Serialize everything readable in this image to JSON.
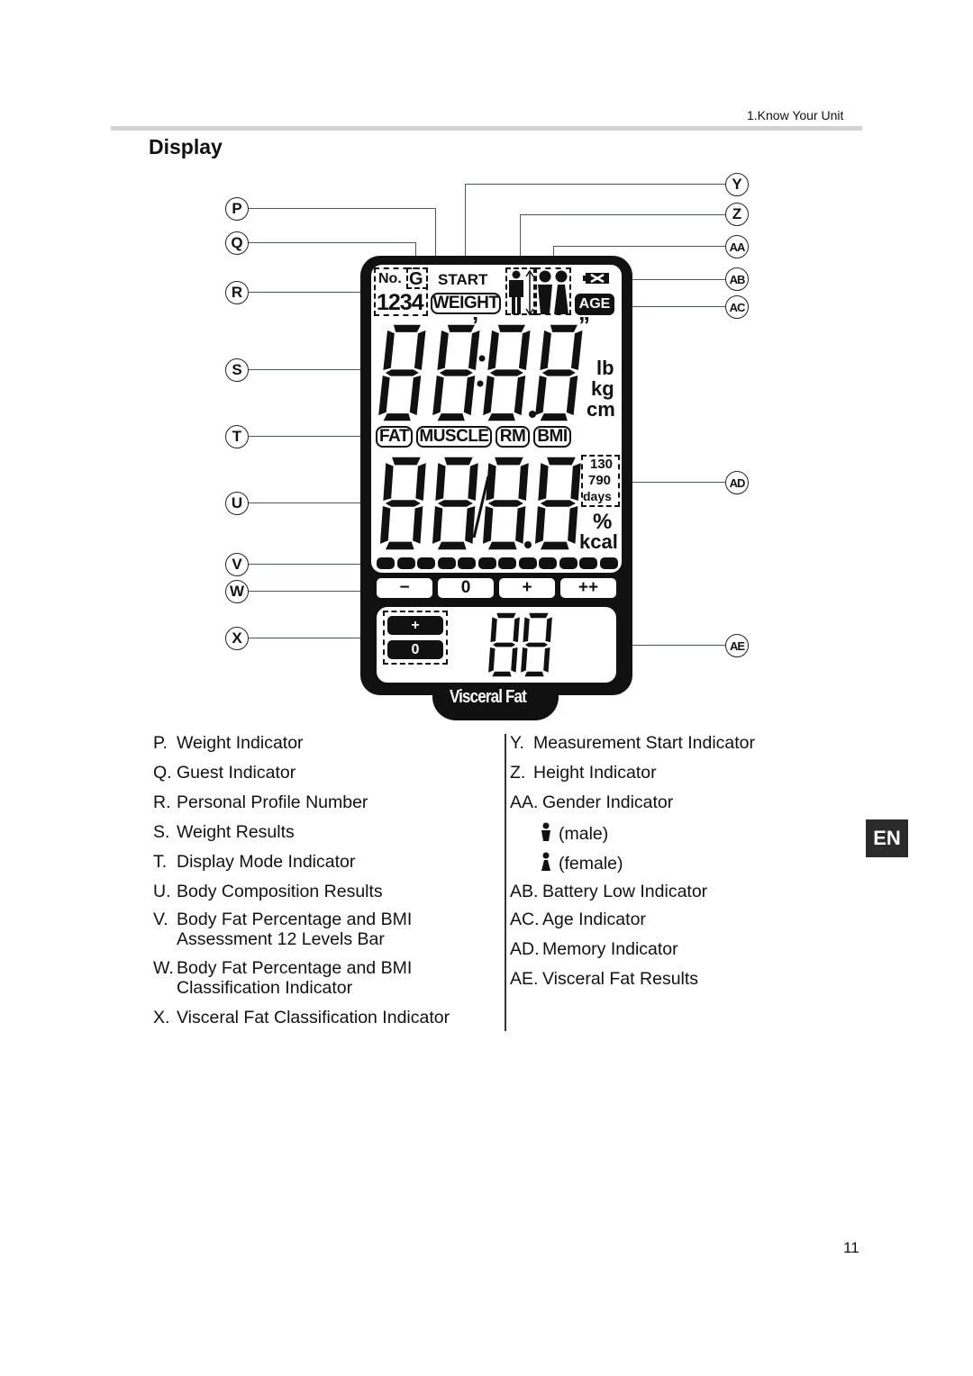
{
  "header": {
    "chapter": "1.Know Your Unit"
  },
  "section": {
    "title": "Display"
  },
  "diagram": {
    "callouts_left": [
      "P",
      "Q",
      "R",
      "S",
      "T",
      "U",
      "V",
      "W",
      "X"
    ],
    "callouts_right": [
      "Y",
      "Z",
      "AA",
      "AB",
      "AC",
      "AD",
      "AE"
    ],
    "lcd": {
      "no_label": "No.",
      "guest_label": "G",
      "start_label": "START",
      "profile_digits": "1234",
      "weight_label": "WEIGHT",
      "age_label": "AGE",
      "units_top": [
        "lb",
        "kg",
        "cm"
      ],
      "mode_labels": [
        "FAT",
        "MUSCLE",
        "RM",
        "BMI"
      ],
      "memory_values": [
        "130",
        "790",
        "days"
      ],
      "units_bottom": [
        "%",
        "kcal"
      ],
      "level_bar_segments": 12,
      "classification_buttons": [
        "−",
        "0",
        "+",
        "++"
      ],
      "visceral_buttons": [
        "+",
        "0"
      ],
      "visceral_label": "Visceral Fat",
      "prime_mark": "’",
      "double_prime_mark": "”"
    }
  },
  "legend_left": [
    {
      "key": "P.",
      "text": "Weight Indicator"
    },
    {
      "key": "Q.",
      "text": "Guest Indicator"
    },
    {
      "key": "R.",
      "text": "Personal Profile Number"
    },
    {
      "key": "S.",
      "text": "Weight Results"
    },
    {
      "key": "T.",
      "text": "Display Mode Indicator"
    },
    {
      "key": "U.",
      "text": "Body Composition Results"
    },
    {
      "key": "V.",
      "text": "Body Fat Percentage and BMI",
      "text2": "Assessment 12 Levels Bar"
    },
    {
      "key": "W.",
      "text": "Body Fat Percentage and BMI",
      "text2": "Classification Indicator"
    },
    {
      "key": "X.",
      "text": "Visceral Fat Classification Indicator"
    }
  ],
  "legend_right": [
    {
      "key": "Y.",
      "text": "Measurement Start Indicator"
    },
    {
      "key": "Z.",
      "text": "Height Indicator"
    },
    {
      "key": "AA.",
      "text": "Gender Indicator"
    },
    {
      "key": "",
      "text": "(male)",
      "icon": "male-figure-icon"
    },
    {
      "key": "",
      "text": "(female)",
      "icon": "female-figure-icon"
    },
    {
      "key": "AB.",
      "text": "Battery Low Indicator"
    },
    {
      "key": "AC.",
      "text": "Age Indicator"
    },
    {
      "key": "AD.",
      "text": "Memory Indicator"
    },
    {
      "key": "AE.",
      "text": "Visceral Fat Results"
    }
  ],
  "language_tab": "EN",
  "page_number": "11"
}
